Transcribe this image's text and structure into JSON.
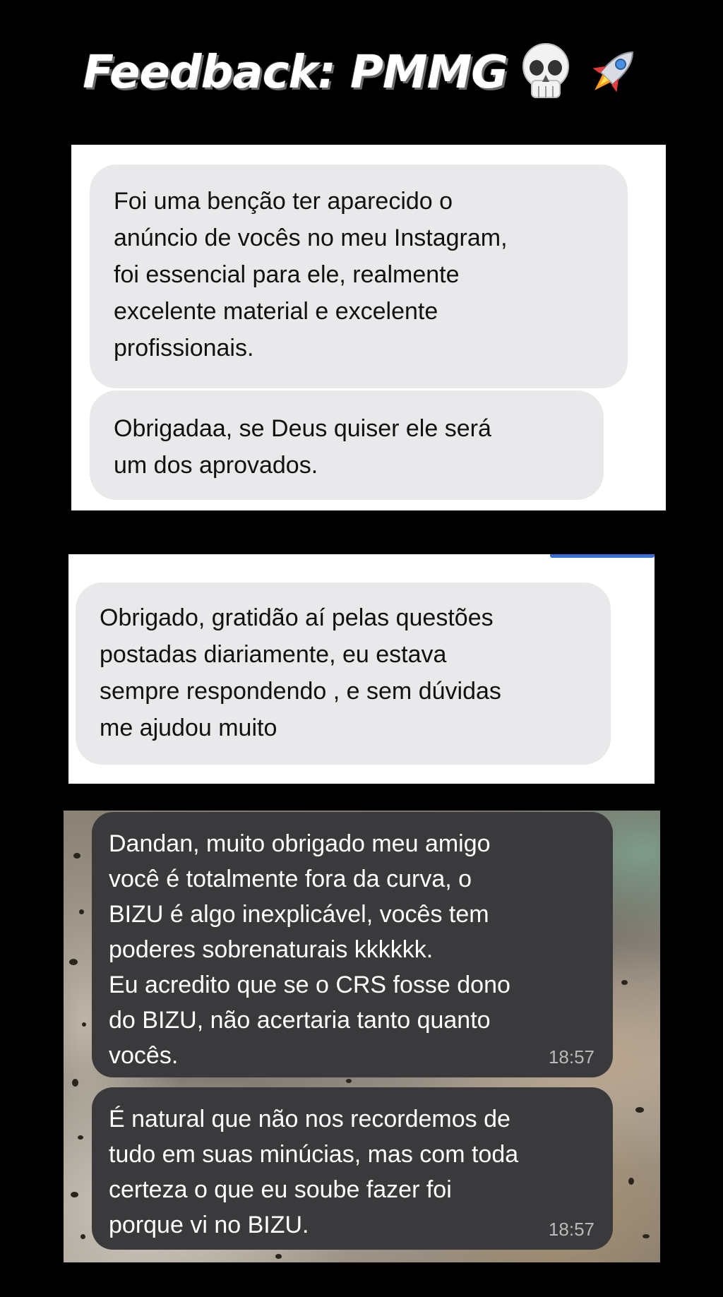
{
  "header": {
    "title": "Feedback: PMMG",
    "emojis": [
      "skull-icon",
      "rocket-icon"
    ]
  },
  "screenshot1": {
    "messages": [
      {
        "text": "Foi uma benção ter aparecido o\nanúncio de vocês no meu Instagram,\nfoi essencial para ele, realmente\nexcelente material e excelente\nprofissionais."
      },
      {
        "text": "Obrigadaa, se Deus quiser ele será\num dos aprovados."
      }
    ]
  },
  "screenshot2": {
    "messages": [
      {
        "text": "Obrigado, gratidão aí pelas questões\npostadas diariamente,  eu estava\nsempre respondendo , e sem dúvidas\nme ajudou muito"
      }
    ]
  },
  "screenshot3": {
    "messages": [
      {
        "text": "Dandan, muito obrigado meu amigo\nvocê é totalmente fora da curva, o\nBIZU é algo inexplicável, vocês tem\npoderes sobrenaturais kkkkkk.\nEu acredito que se o CRS fosse dono\ndo BIZU, não acertaria tanto quanto\nvocês.",
        "time": "18:57"
      },
      {
        "text": "É natural que não nos recordemos de\ntudo em suas minúcias, mas com toda\ncerteza o que eu soube fazer foi\nporque vi no BIZU.",
        "time": "18:57"
      }
    ]
  },
  "colors": {
    "background": "#000000",
    "light_bubble": "#e9e9eb",
    "dark_bubble": "#3a3a3c",
    "accent_blue": "#3b6fd8"
  }
}
